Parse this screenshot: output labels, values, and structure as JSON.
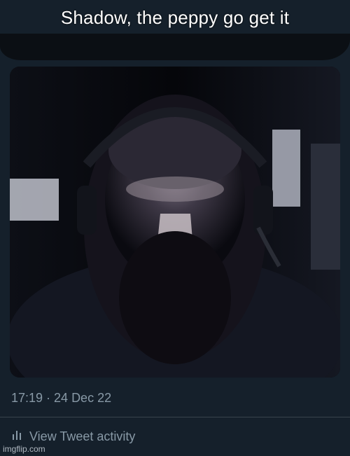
{
  "meme": {
    "caption": "Shadow, the peppy go get it"
  },
  "tweet": {
    "timestamp": "17:19 · 24 Dec 22",
    "activity_label": "View Tweet activity",
    "activity_icon": "bar-chart-icon"
  },
  "watermark": "imgflip.com",
  "colors": {
    "background": "#15202b",
    "secondary_text": "#8899a6",
    "divider": "#38444d",
    "caption_text": "#ffffff"
  }
}
